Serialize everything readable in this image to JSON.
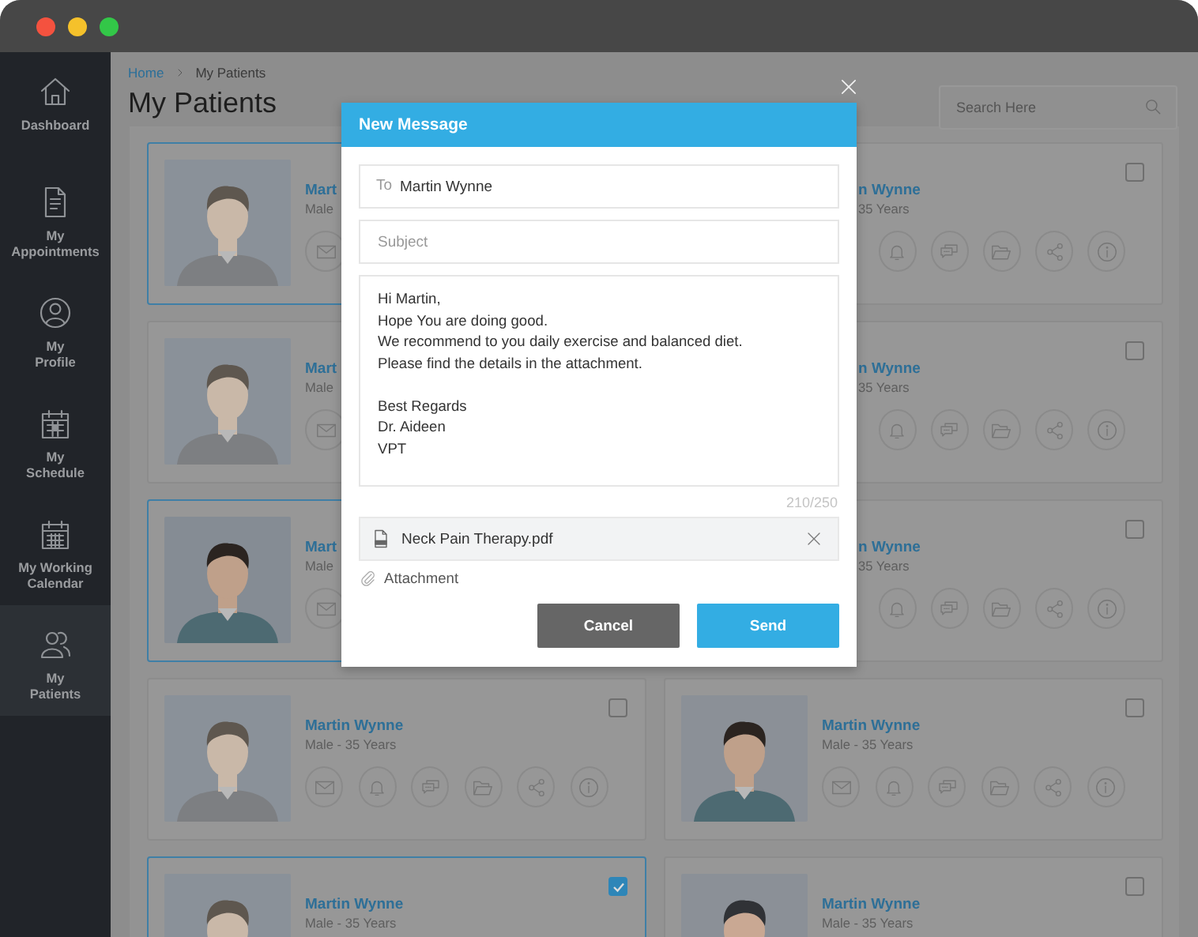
{
  "window": {
    "buttons": [
      {
        "color": "#f4523f"
      },
      {
        "color": "#f5c12b"
      },
      {
        "color": "#33c748"
      }
    ]
  },
  "sidebar": {
    "items": [
      {
        "label": "Dashboard",
        "selected": false
      },
      {
        "label": "My\nAppointments",
        "selected": false
      },
      {
        "label": "My\nProfile",
        "selected": false
      },
      {
        "label": "My\nSchedule",
        "selected": false
      },
      {
        "label": "My Working\nCalendar",
        "selected": false
      },
      {
        "label": "My\nPatients",
        "selected": true
      }
    ]
  },
  "breadcrumb": [
    {
      "label": "Home",
      "kind": "link"
    },
    {
      "label": "My Patients",
      "kind": "current"
    }
  ],
  "page_title": "My Patients",
  "search": {
    "placeholder": "Search Here"
  },
  "patients": [
    {
      "kind": "left-part",
      "name": "Mart",
      "info": "Male",
      "selected": true
    },
    {
      "kind": "right-part",
      "name": "n Wynne",
      "info": "35 Years",
      "selected": false,
      "checked": false
    },
    {
      "kind": "left-part",
      "name": "Mart",
      "info": "Male",
      "selected": false
    },
    {
      "kind": "right-part",
      "name": "n Wynne",
      "info": "35 Years",
      "selected": false,
      "checked": false
    },
    {
      "kind": "left-part",
      "name": "Mart",
      "info": "Male",
      "selected": true
    },
    {
      "kind": "right-part",
      "name": "n Wynne",
      "info": "35 Years",
      "selected": false,
      "checked": false
    },
    {
      "kind": "full",
      "name": "Martin Wynne",
      "info": "Male - 35 Years",
      "selected": false,
      "checked": false
    },
    {
      "kind": "full",
      "name": "Martin Wynne",
      "info": "Male - 35 Years",
      "selected": false,
      "checked": false
    },
    {
      "kind": "cut",
      "name": "Martin Wynne",
      "info": "Male - 35 Years",
      "selected": true,
      "checked": true
    },
    {
      "kind": "cut",
      "name": "Martin Wynne",
      "info": "Male - 35 Years",
      "selected": false,
      "checked": false
    }
  ],
  "dialog": {
    "title": "New Message",
    "to_label": "To",
    "to": "Martin Wynne",
    "subject": {
      "placeholder": "Subject"
    },
    "message": "Hi Martin,\nHope You are doing good.\nWe recommend to you daily exercise and balanced diet.\nPlease find the details in the attachment.\n\nBest Regards\nDr. Aideen\nVPT",
    "counter": "210/250",
    "attachment": {
      "filename": "Neck Pain Therapy.pdf"
    },
    "attach_link": "Attachment",
    "buttons": [
      {
        "label": "Cancel",
        "kind": "secondary"
      },
      {
        "label": "Send",
        "kind": "primary"
      }
    ]
  }
}
